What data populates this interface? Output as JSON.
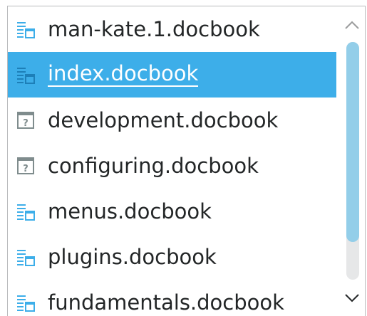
{
  "file_list": {
    "selected_index": 1,
    "items": [
      {
        "label": "man-kate.1.docbook",
        "icon": "docbook-file-icon"
      },
      {
        "label": "index.docbook",
        "icon": "docbook-file-icon"
      },
      {
        "label": "development.docbook",
        "icon": "unknown-file-icon"
      },
      {
        "label": "configuring.docbook",
        "icon": "unknown-file-icon"
      },
      {
        "label": "menus.docbook",
        "icon": "docbook-file-icon"
      },
      {
        "label": "plugins.docbook",
        "icon": "docbook-file-icon"
      },
      {
        "label": "fundamentals.docbook",
        "icon": "docbook-file-icon"
      }
    ]
  },
  "scrollbar": {
    "up_icon": "chevron-up-icon",
    "down_icon": "chevron-down-icon",
    "visible_fraction": 0.84,
    "scroll_position": 0.0
  },
  "colors": {
    "selection": "#3daee9",
    "text": "#232627",
    "icon_blue": "#3daee9",
    "scroll_thumb": "#93cee9"
  }
}
